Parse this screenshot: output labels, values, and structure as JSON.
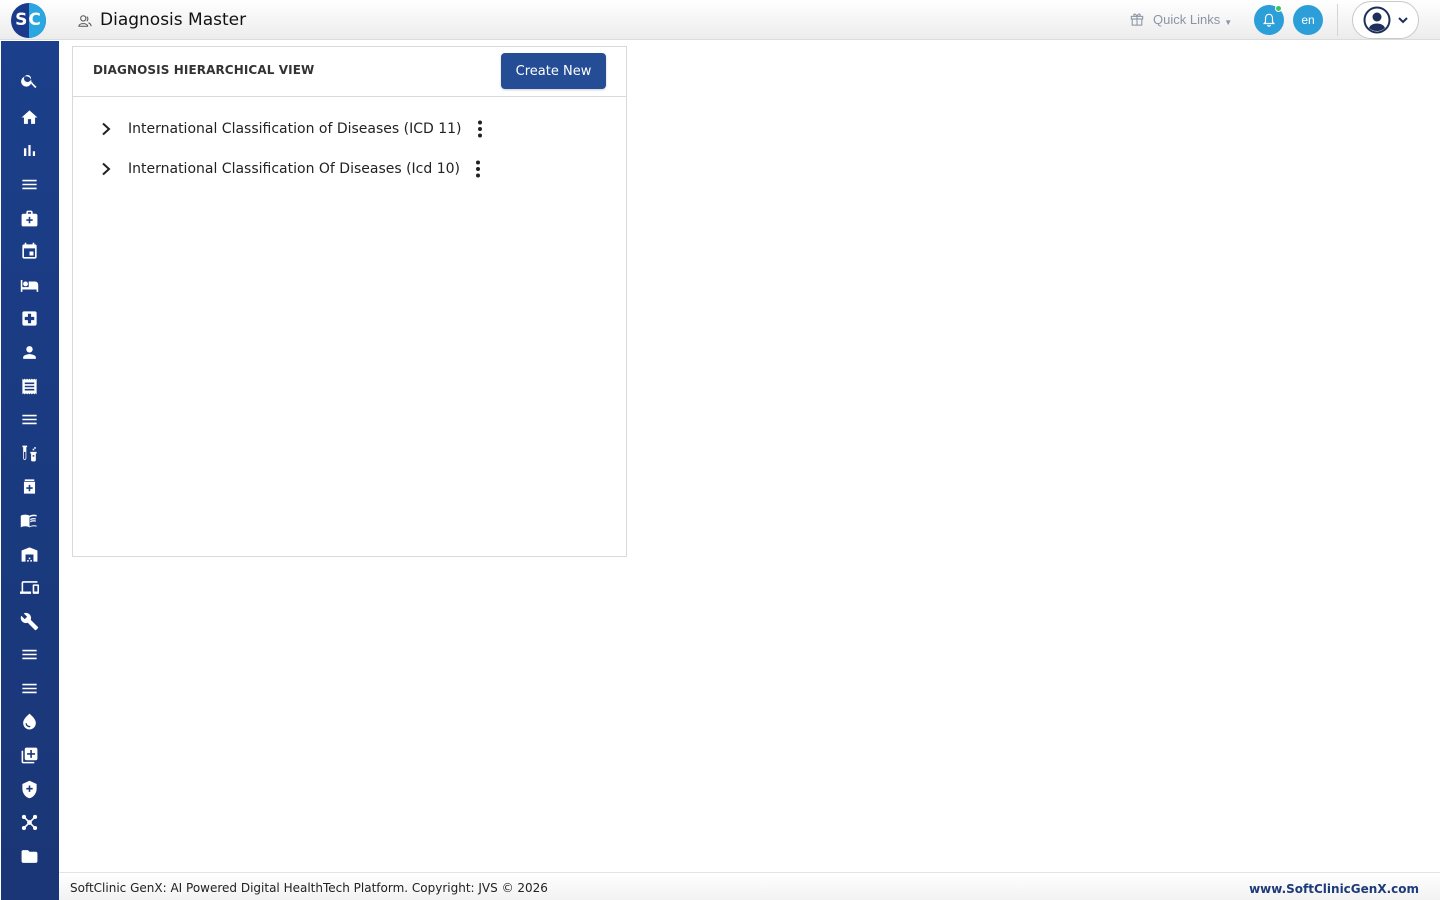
{
  "header": {
    "logo_text": "SC",
    "page_title": "Diagnosis Master",
    "quick_links_label": "Quick Links",
    "language": "en"
  },
  "sidebar": {
    "items": [
      {
        "icon": "search-icon"
      },
      {
        "icon": "home-icon"
      },
      {
        "icon": "bar-chart-icon"
      },
      {
        "icon": "menu-icon"
      },
      {
        "icon": "medical-kit-icon"
      },
      {
        "icon": "calendar-icon"
      },
      {
        "icon": "bed-icon"
      },
      {
        "icon": "medical-plus-icon"
      },
      {
        "icon": "person-icon"
      },
      {
        "icon": "receipt-icon"
      },
      {
        "icon": "menu-icon"
      },
      {
        "icon": "lab-vials-icon"
      },
      {
        "icon": "medicine-bottle-icon"
      },
      {
        "icon": "book-icon"
      },
      {
        "icon": "warehouse-icon"
      },
      {
        "icon": "devices-icon"
      },
      {
        "icon": "wrench-icon"
      },
      {
        "icon": "menu-icon"
      },
      {
        "icon": "menu-icon"
      },
      {
        "icon": "blood-drop-icon"
      },
      {
        "icon": "add-library-icon"
      },
      {
        "icon": "shield-plus-icon"
      },
      {
        "icon": "network-icon"
      },
      {
        "icon": "folder-icon"
      }
    ]
  },
  "card": {
    "title": "DIAGNOSIS HIERARCHICAL VIEW",
    "create_button": "Create New",
    "tree": [
      {
        "label": "International Classification of Diseases (ICD 11)"
      },
      {
        "label": "International Classification Of Diseases (Icd 10)"
      }
    ]
  },
  "footer": {
    "copyright": "SoftClinic GenX: AI Powered Digital HealthTech Platform. Copyright: JVS © 2026",
    "website": "www.SoftClinicGenX.com"
  },
  "colors": {
    "sidebar": "#1b3f8a",
    "primary_button": "#244d96",
    "accent": "#2c9fd9"
  }
}
